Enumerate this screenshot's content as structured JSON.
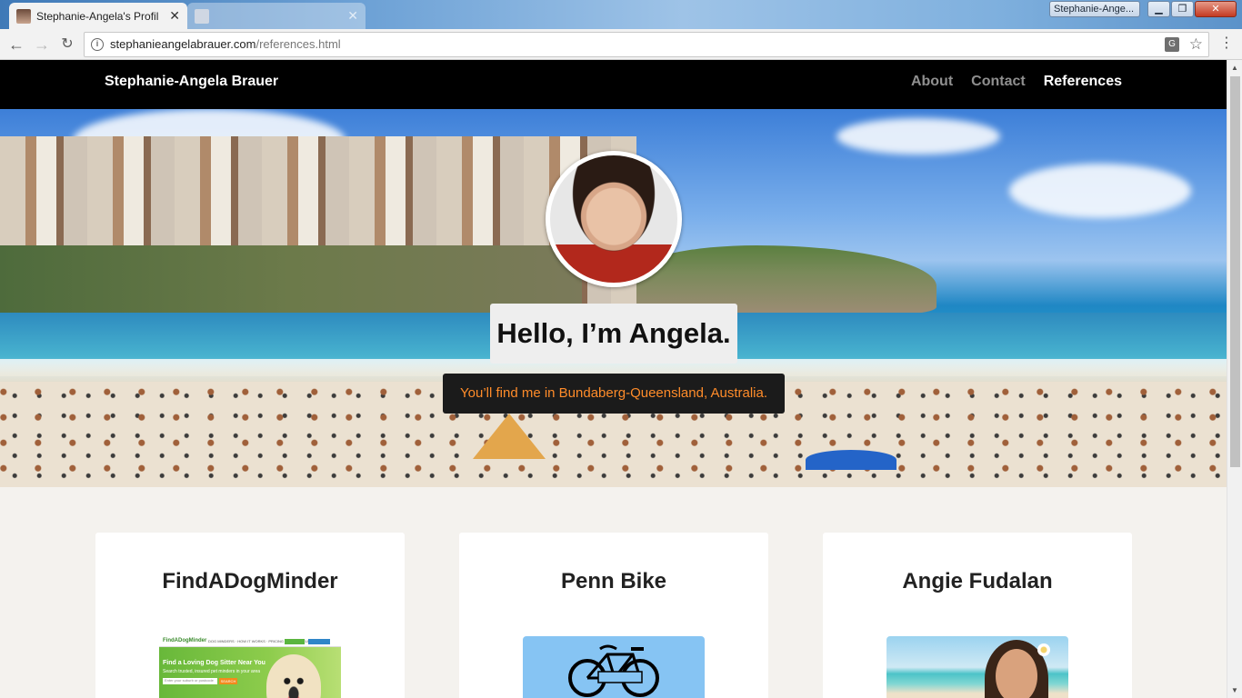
{
  "browser": {
    "tabs": [
      {
        "title": "Stephanie-Angela's Profil",
        "active": true
      },
      {
        "title": "",
        "active": false
      }
    ],
    "window_label": "Stephanie-Ange...",
    "url_host": "stephanieangelabrauer.com",
    "url_path": "/references.html",
    "info_icon": "i",
    "translate_icon": "G"
  },
  "site": {
    "brand": "Stephanie-Angela Brauer",
    "nav": [
      {
        "label": "About",
        "current": false
      },
      {
        "label": "Contact",
        "current": false
      },
      {
        "label": "References",
        "current": true
      }
    ]
  },
  "hero": {
    "title": "Hello, I’m Angela.",
    "subtitle": "You’ll find me in Bundaberg-Queensland, Australia."
  },
  "cards": [
    {
      "title": "FindADogMinder",
      "thumb": "dog-minder-site"
    },
    {
      "title": "Penn Bike",
      "thumb": "penn-bike-logo"
    },
    {
      "title": "Angie Fudalan",
      "thumb": "beach-portrait"
    }
  ],
  "thumb_dog": {
    "logo": "FindADogMinder",
    "nav": "DOG MINDERS · HOW IT WORKS · PRICING · BLOG · HELP",
    "headline": "Find a Loving Dog Sitter Near You",
    "sub": "Search trusted, insured pet minders in your area",
    "search_placeholder": "Enter your suburb or postcode",
    "search_button": "SEARCH"
  },
  "colors": {
    "nav_bg": "#000000",
    "subtitle_text": "#ff8c2a",
    "page_bg": "#f4f2ee"
  }
}
